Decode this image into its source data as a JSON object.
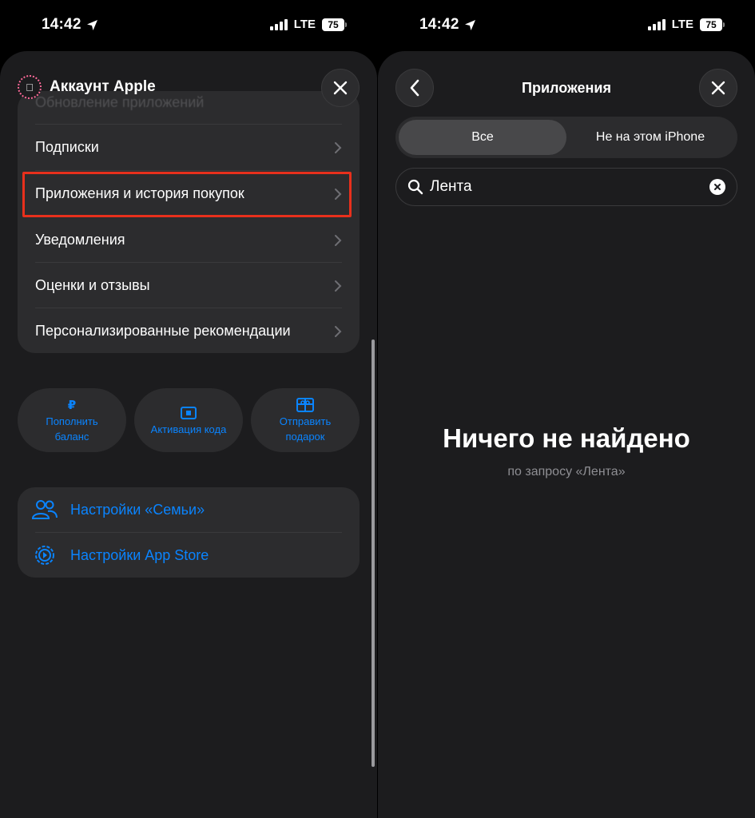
{
  "left": {
    "status": {
      "time": "14:42",
      "network": "LTE",
      "battery": "75"
    },
    "header": {
      "title": "Аккаунт Apple"
    },
    "list": {
      "faded_item": "Обновление приложений",
      "items": [
        {
          "label": "Подписки"
        },
        {
          "label": "Приложения и история покупок"
        },
        {
          "label": "Уведомления"
        },
        {
          "label": "Оценки и отзывы"
        },
        {
          "label": "Персонализированные рекомендации"
        }
      ]
    },
    "actions": [
      {
        "icon": "ruble-icon",
        "line1": "Пополнить",
        "line2": "баланс"
      },
      {
        "icon": "card-icon",
        "line1": "Активация кода",
        "line2": ""
      },
      {
        "icon": "gift-icon",
        "line1": "Отправить",
        "line2": "подарок"
      }
    ],
    "settings": [
      {
        "icon": "family-icon",
        "label": "Настройки «Семьи»"
      },
      {
        "icon": "appstore-gear-icon",
        "label": "Настройки App Store"
      }
    ],
    "highlight_color": "#e8301c",
    "accent": "#0a84ff"
  },
  "right": {
    "status": {
      "time": "14:42",
      "network": "LTE",
      "battery": "75"
    },
    "nav": {
      "title": "Приложения"
    },
    "segments": {
      "all": "Все",
      "not_on_device": "Не на этом iPhone",
      "selected": "Все"
    },
    "search": {
      "value": "Лента"
    },
    "empty": {
      "title": "Ничего не найдено",
      "subtitle": "по запросу «Лента»"
    }
  }
}
